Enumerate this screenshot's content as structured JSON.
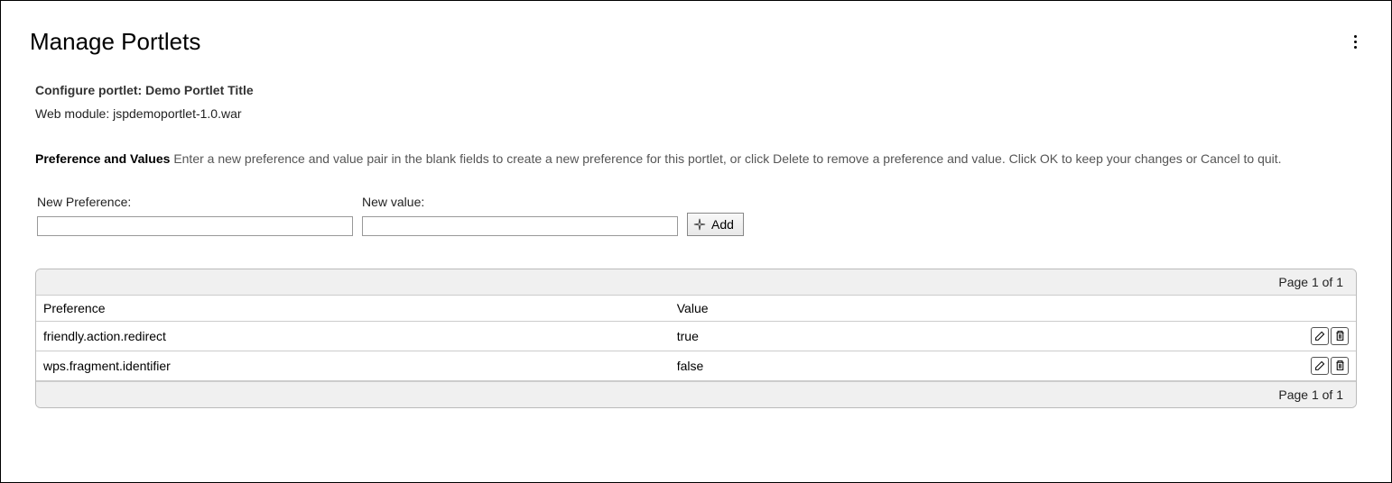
{
  "header": {
    "title": "Manage Portlets"
  },
  "configure": {
    "label_prefix": "Configure portlet: ",
    "portlet_title": "Demo Portlet Title",
    "web_module_prefix": "Web module: ",
    "web_module_value": "jspdemoportlet-1.0.war"
  },
  "instructions": {
    "heading": "Preference and Values",
    "body": "Enter a new preference and value pair in the blank fields to create a new preference for this portlet, or click Delete to remove a preference and value. Click OK to keep your changes or Cancel to quit."
  },
  "form": {
    "new_pref_label": "New Preference:",
    "new_pref_value": "",
    "new_val_label": "New value:",
    "new_val_value": "",
    "add_label": "Add"
  },
  "pager": {
    "top_text": "Page 1 of 1",
    "bottom_text": "Page 1 of 1"
  },
  "table": {
    "col_preference": "Preference",
    "col_value": "Value",
    "rows": [
      {
        "preference": "friendly.action.redirect",
        "value": "true"
      },
      {
        "preference": "wps.fragment.identifier",
        "value": "false"
      }
    ]
  }
}
